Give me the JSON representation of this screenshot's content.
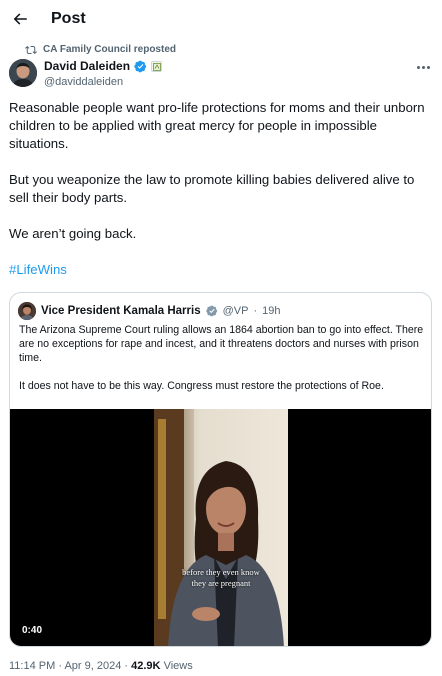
{
  "header": {
    "title": "Post",
    "back_icon": "arrow-left-icon"
  },
  "repost": {
    "label": "CA Family Council reposted",
    "icon": "repost-icon"
  },
  "author": {
    "name": "David Daleiden",
    "handle": "@daviddaleiden",
    "verified_color": "#1d9bf0"
  },
  "post": {
    "paragraphs": [
      "Reasonable people want pro-life protections for moms and their unborn children to be applied with great mercy for people in impossible situations.",
      "But you weaponize the law to promote killing babies delivered alive to sell their body parts.",
      "We aren’t going back."
    ],
    "hashtag": "#LifeWins"
  },
  "quote": {
    "name": "Vice President Kamala Harris",
    "handle": "@VP",
    "separator": "·",
    "time": "19h",
    "paragraphs": [
      "The Arizona Supreme Court ruling allows an 1864 abortion ban to go into effect. There are no exceptions for rape and incest, and it threatens doctors and nurses with prison time.",
      "It does not have to be this way. Congress must restore the protections of Roe."
    ],
    "video": {
      "caption_line1": "before they even know",
      "caption_line2": "they are pregnant",
      "duration": "0:40"
    }
  },
  "meta": {
    "time": "11:14 PM",
    "separator": "·",
    "date": "Apr 9, 2024",
    "views_count": "42.9K",
    "views_label": "Views"
  },
  "colors": {
    "accent": "#1d9bf0",
    "secondary_text": "#536471",
    "border": "#cfd9de"
  }
}
